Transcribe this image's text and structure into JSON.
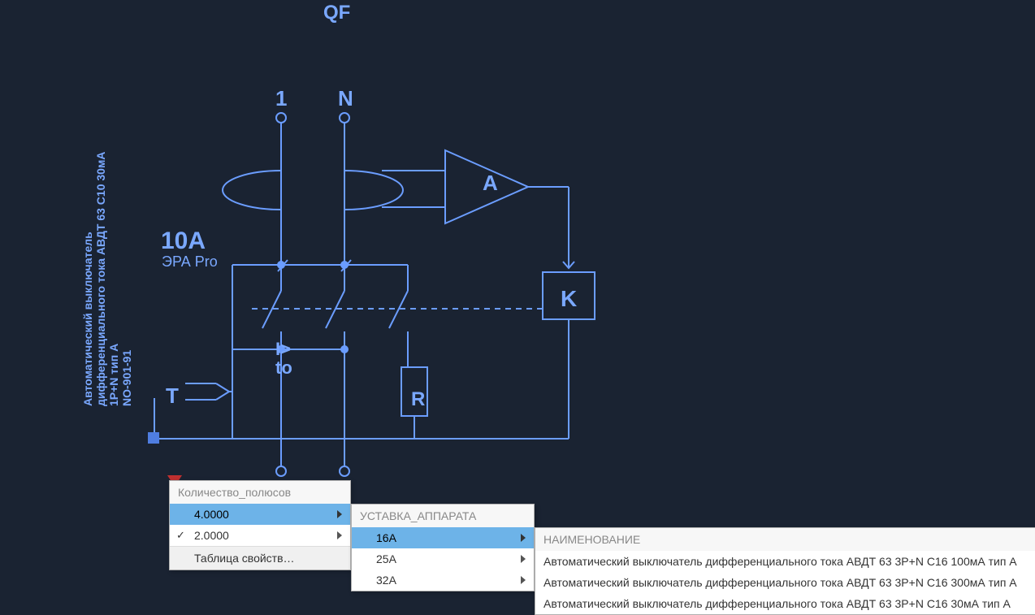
{
  "labels": {
    "qf": "QF",
    "pole1": "1",
    "poleN": "N",
    "rating": "10A",
    "series": "ЭРА Pro",
    "ito_i": "I>",
    "ito_to": "to",
    "t_button": "T",
    "amp": "A",
    "relay": "K",
    "resistor": "R"
  },
  "side_label": {
    "line1": "Автоматический выключатель",
    "line2": "дифференциального тока АВДТ 63 С10 30мА",
    "line3": "1P+N тип А",
    "line4": "NO-901-91"
  },
  "menus": {
    "poles": {
      "title": "Количество_полюсов",
      "items": [
        {
          "value": "4.0000",
          "checked": false,
          "highlighted": true
        },
        {
          "value": "2.0000",
          "checked": true,
          "highlighted": false
        }
      ],
      "footer": "Таблица свойств…"
    },
    "rating": {
      "title": "УСТАВКА_АППАРАТА",
      "items": [
        {
          "value": "16A",
          "highlighted": true
        },
        {
          "value": "25A",
          "highlighted": false
        },
        {
          "value": "32A",
          "highlighted": false
        }
      ]
    },
    "name": {
      "title": "НАИМЕНОВАНИЕ",
      "items": [
        {
          "value": "Автоматический выключатель дифференциального тока АВДТ 63 3P+N C16 100мА тип A"
        },
        {
          "value": "Автоматический выключатель дифференциального тока АВДТ 63 3P+N C16 300мА тип A"
        },
        {
          "value": "Автоматический выключатель дифференциального тока АВДТ 63 3P+N C16 30мА тип A"
        }
      ]
    }
  }
}
